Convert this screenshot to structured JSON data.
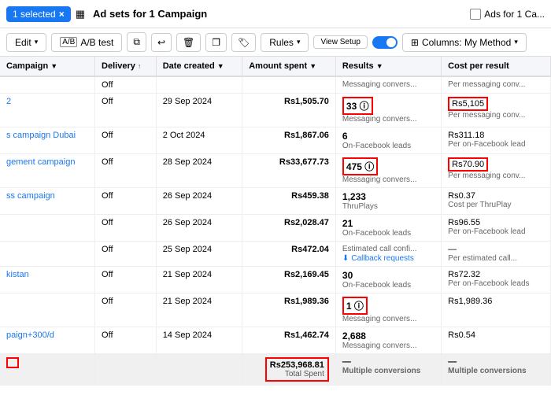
{
  "topbar": {
    "selected_label": "1 selected",
    "ad_sets_title": "Ad sets for 1 Campaign",
    "ads_label": "Ads for 1 Ca...",
    "close_icon": "×"
  },
  "toolbar": {
    "edit_label": "Edit",
    "ab_test_label": "A/B test",
    "duplicate_icon": "⧉",
    "undo_icon": "↩",
    "delete_icon": "🗑",
    "copy_icon": "❐",
    "tag_icon": "🏷",
    "rules_label": "Rules",
    "view_setup_label": "View Setup",
    "columns_label": "Columns: My Method"
  },
  "table": {
    "headers": [
      {
        "id": "campaign",
        "label": "Campaign",
        "sort": "▼"
      },
      {
        "id": "delivery",
        "label": "Delivery",
        "sort": "↑"
      },
      {
        "id": "date_created",
        "label": "Date created",
        "sort": "▼"
      },
      {
        "id": "amount_spent",
        "label": "Amount spent",
        "sort": "▼"
      },
      {
        "id": "results",
        "label": "Results",
        "sort": "▼"
      },
      {
        "id": "cost_per_result",
        "label": "Cost per result",
        "sort": ""
      }
    ],
    "rows": [
      {
        "campaign": "",
        "delivery": "Off",
        "date_created": "",
        "amount_spent": "",
        "results_val": "",
        "results_sub": "Messaging convers...",
        "results_extra": "Per messaging conv...",
        "cost": "",
        "cost_sub": "Per messaging conv...",
        "highlighted_result": false,
        "highlighted_cost": false
      },
      {
        "campaign": "2",
        "delivery": "Off",
        "date_created": "29 Sep 2024",
        "amount_spent": "Rs1,505.70",
        "results_val": "33",
        "results_sub": "Messaging convers...",
        "cost": "Rs5,105",
        "cost_sub": "Per messaging conv...",
        "highlighted_result": true,
        "highlighted_cost": true
      },
      {
        "campaign": "s campaign Dubai",
        "delivery": "Off",
        "date_created": "2 Oct 2024",
        "amount_spent": "Rs1,867.06",
        "results_val": "6",
        "results_sub": "On-Facebook leads",
        "cost": "Rs311.18",
        "cost_sub": "Per on-Facebook lead",
        "highlighted_result": false,
        "highlighted_cost": false
      },
      {
        "campaign": "gement campaign",
        "delivery": "Off",
        "date_created": "28 Sep 2024",
        "amount_spent": "Rs33,677.73",
        "results_val": "475",
        "results_sub": "Messaging convers...",
        "cost": "Rs70.90",
        "cost_sub": "Per messaging conv...",
        "highlighted_result": true,
        "highlighted_cost": true
      },
      {
        "campaign": "ss campaign",
        "delivery": "Off",
        "date_created": "26 Sep 2024",
        "amount_spent": "Rs459.38",
        "results_val": "1,233",
        "results_sub": "ThruPlays",
        "cost": "Rs0.37",
        "cost_sub": "Cost per ThruPlay",
        "highlighted_result": false,
        "highlighted_cost": false
      },
      {
        "campaign": "",
        "delivery": "Off",
        "date_created": "26 Sep 2024",
        "amount_spent": "Rs2,028.47",
        "results_val": "21",
        "results_sub": "On-Facebook leads",
        "cost": "Rs96.55",
        "cost_sub": "Per on-Facebook lead",
        "highlighted_result": false,
        "highlighted_cost": false
      },
      {
        "campaign": "",
        "delivery": "Off",
        "date_created": "25 Sep 2024",
        "amount_spent": "Rs472.04",
        "results_val": "",
        "results_sub": "Estimated call confi...",
        "results_extra_label": "Callback requests",
        "cost": "—",
        "cost_sub": "Per estimated call...",
        "highlighted_result": false,
        "highlighted_cost": false,
        "callback": true
      },
      {
        "campaign": "kistan",
        "delivery": "Off",
        "date_created": "21 Sep 2024",
        "amount_spent": "Rs2,169.45",
        "results_val": "30",
        "results_sub": "On-Facebook leads",
        "cost": "Rs72.32",
        "cost_sub": "Per on-Facebook leads",
        "highlighted_result": false,
        "highlighted_cost": false
      },
      {
        "campaign": "",
        "delivery": "Off",
        "date_created": "21 Sep 2024",
        "amount_spent": "Rs1,989.36",
        "results_val": "1",
        "results_sub": "Messaging convers...",
        "cost": "Rs1,989.36",
        "cost_sub": "",
        "highlighted_result": true,
        "highlighted_cost": false
      },
      {
        "campaign": "paign+300/d",
        "delivery": "Off",
        "date_created": "14 Sep 2024",
        "amount_spent": "Rs1,462.74",
        "results_val": "2,688",
        "results_sub": "Messaging convers...",
        "cost": "Rs0.54",
        "cost_sub": "",
        "highlighted_result": false,
        "highlighted_cost": false
      }
    ],
    "total": {
      "amount": "Rs253,968.81",
      "amount_label": "Total Spent",
      "results_val": "—",
      "results_sub": "Multiple conversions",
      "cost_val": "—",
      "cost_sub": "Multiple conversions"
    }
  }
}
